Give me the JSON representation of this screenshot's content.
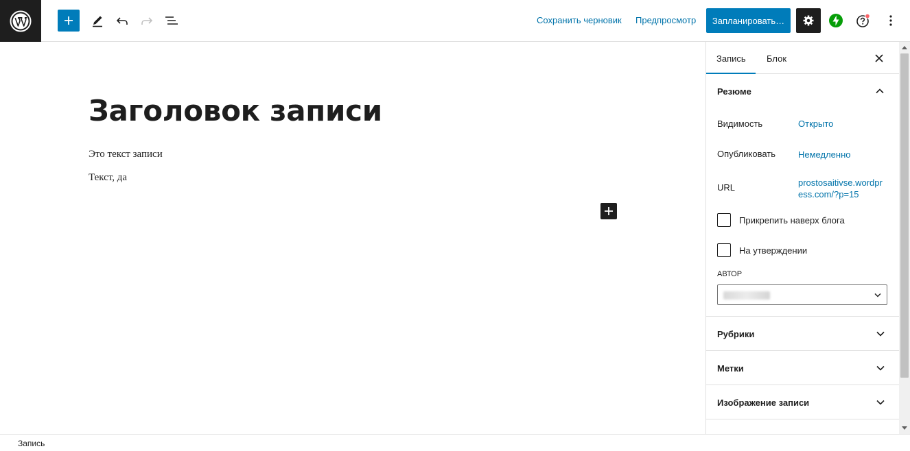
{
  "toolbar": {
    "save_draft_label": "Сохранить черновик",
    "preview_label": "Предпросмотр",
    "schedule_label": "Запланировать…"
  },
  "editor": {
    "title": "Заголовок записи",
    "paragraphs": [
      "Это текст записи",
      "Текст, да"
    ]
  },
  "sidebar": {
    "tabs": [
      {
        "label": "Запись",
        "active": true
      },
      {
        "label": "Блок",
        "active": false
      }
    ],
    "summary": {
      "title": "Резюме",
      "visibility_label": "Видимость",
      "visibility_value": "Открыто",
      "publish_label": "Опубликовать",
      "publish_value": "Немедленно",
      "url_label": "URL",
      "url_value": "prostosaitivse.wordpress.com/?p=15",
      "sticky_label": "Прикрепить наверх блога",
      "pending_label": "На утверждении",
      "author_label": "Автор"
    },
    "panels": [
      {
        "label": "Рубрики"
      },
      {
        "label": "Метки"
      },
      {
        "label": "Изображение записи"
      }
    ]
  },
  "footer": {
    "breadcrumb": "Запись"
  },
  "colors": {
    "accent": "#007cba",
    "link": "#0073aa",
    "dark": "#1e1e1e",
    "jetpack": "#069e08",
    "notification_dot": "#f86368"
  }
}
